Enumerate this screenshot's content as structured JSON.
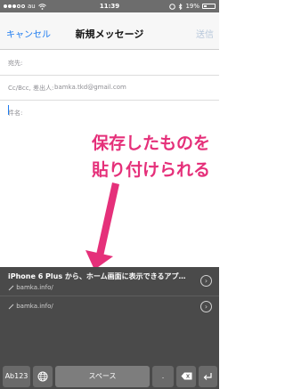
{
  "status_bar": {
    "carrier": "au",
    "time": "11:39",
    "battery_percent": "19%"
  },
  "nav": {
    "cancel": "キャンセル",
    "title": "新規メッセージ",
    "send": "送信"
  },
  "fields": {
    "to_label": "宛先:",
    "cc_label": "Cc/Bcc, 差出人:",
    "cc_value": "bamka.tkd@gmail.com",
    "subject_label": "件名:"
  },
  "annotation": {
    "line1": "保存したものを",
    "line2": "貼り付けられる",
    "color": "#e5307a"
  },
  "suggestions": [
    {
      "title": "iPhone 6 Plus から、ホーム画面に表示できるアプ…",
      "url": "bamka.info/"
    },
    {
      "title": "",
      "url": "bamka.info/"
    }
  ],
  "keyboard": {
    "ab123": "Ab123",
    "space": "スペース",
    "period": "."
  },
  "icons": {
    "globe": "globe-icon",
    "delete": "delete-icon",
    "return": "return-icon",
    "chevron": "chevron-right-icon",
    "link": "link-icon",
    "bluetooth": "bluetooth-icon",
    "wifi": "wifi-icon"
  }
}
